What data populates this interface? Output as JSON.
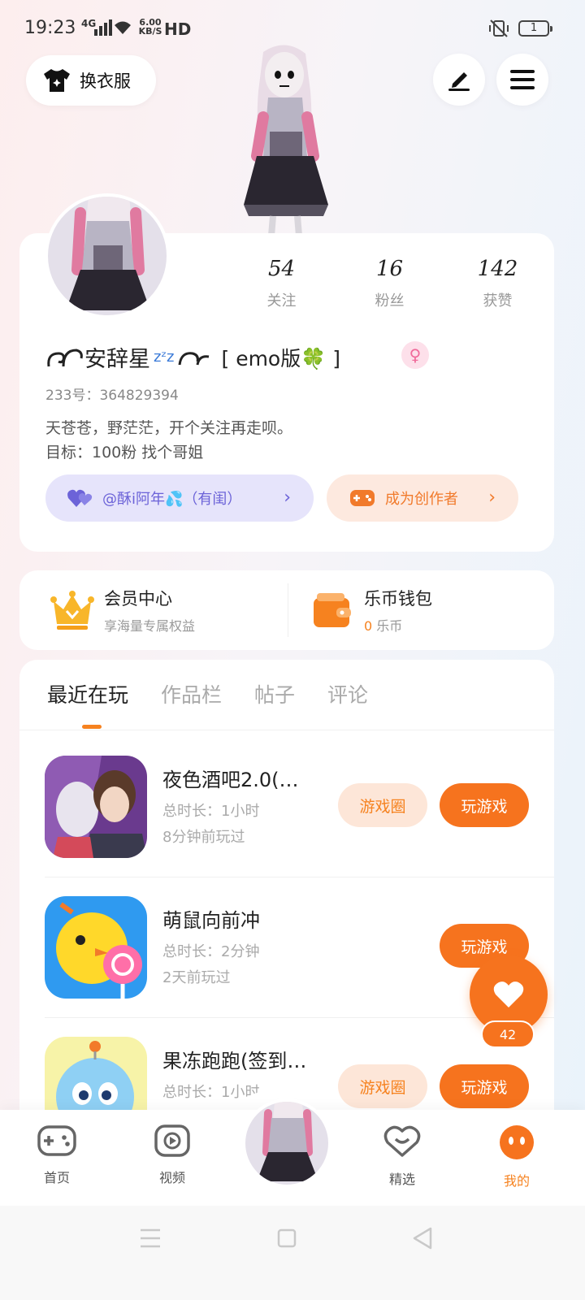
{
  "status_bar": {
    "time": "19:23",
    "network": "4G",
    "speed_value": "6.00",
    "speed_unit": "KB/S",
    "hd": "HD",
    "battery": "1"
  },
  "top": {
    "wardrobe_label": "换衣服",
    "edit_icon": "pen-icon",
    "menu_icon": "menu-icon"
  },
  "profile": {
    "stats": [
      {
        "num": "54",
        "label": "关注"
      },
      {
        "num": "16",
        "label": "粉丝"
      },
      {
        "num": "142",
        "label": "获赞"
      }
    ],
    "nickname": "安辞星",
    "nickname_tag": "[ emo版🍀 ]",
    "gender_symbol": "♀",
    "uid": "233号：364829394",
    "bio_line1": "天苍苍，野茫茫，开个关注再走呗。",
    "bio_line2": "目标：100粉 找个哥姐",
    "guild_label": "@酥i阿年💦（有闺）",
    "creator_label": "成为创作者"
  },
  "services": {
    "member_title": "会员中心",
    "member_sub": "享海量专属权益",
    "wallet_title": "乐币钱包",
    "wallet_amount": "0",
    "wallet_unit": "乐币"
  },
  "tabs": [
    "最近在玩",
    "作品栏",
    "帖子",
    "评论"
  ],
  "games": [
    {
      "name": "夜色酒吧2.0(…",
      "duration": "总时长：1小时",
      "last_played": "8分钟前玩过",
      "circle_label": "游戏圈",
      "play_label": "玩游戏"
    },
    {
      "name": "萌鼠向前冲",
      "duration": "总时长：2分钟",
      "last_played": "2天前玩过",
      "circle_label": "",
      "play_label": "玩游戏"
    },
    {
      "name": "果冻跑跑(签到…",
      "duration": "总时长：1小时",
      "last_played": "",
      "circle_label": "游戏圈",
      "play_label": "玩游戏"
    }
  ],
  "float_like": {
    "count": "42"
  },
  "bottom_nav": [
    {
      "label": "首页",
      "icon": "gamepad-icon"
    },
    {
      "label": "视频",
      "icon": "video-icon"
    },
    {
      "label": "精选",
      "icon": "heart-chat-icon"
    },
    {
      "label": "我的",
      "icon": "face-icon"
    }
  ],
  "colors": {
    "accent": "#f6731e",
    "accent_light": "#fde6d8",
    "guild_bg": "#e6e4fb",
    "guild_text": "#6c63d8"
  }
}
